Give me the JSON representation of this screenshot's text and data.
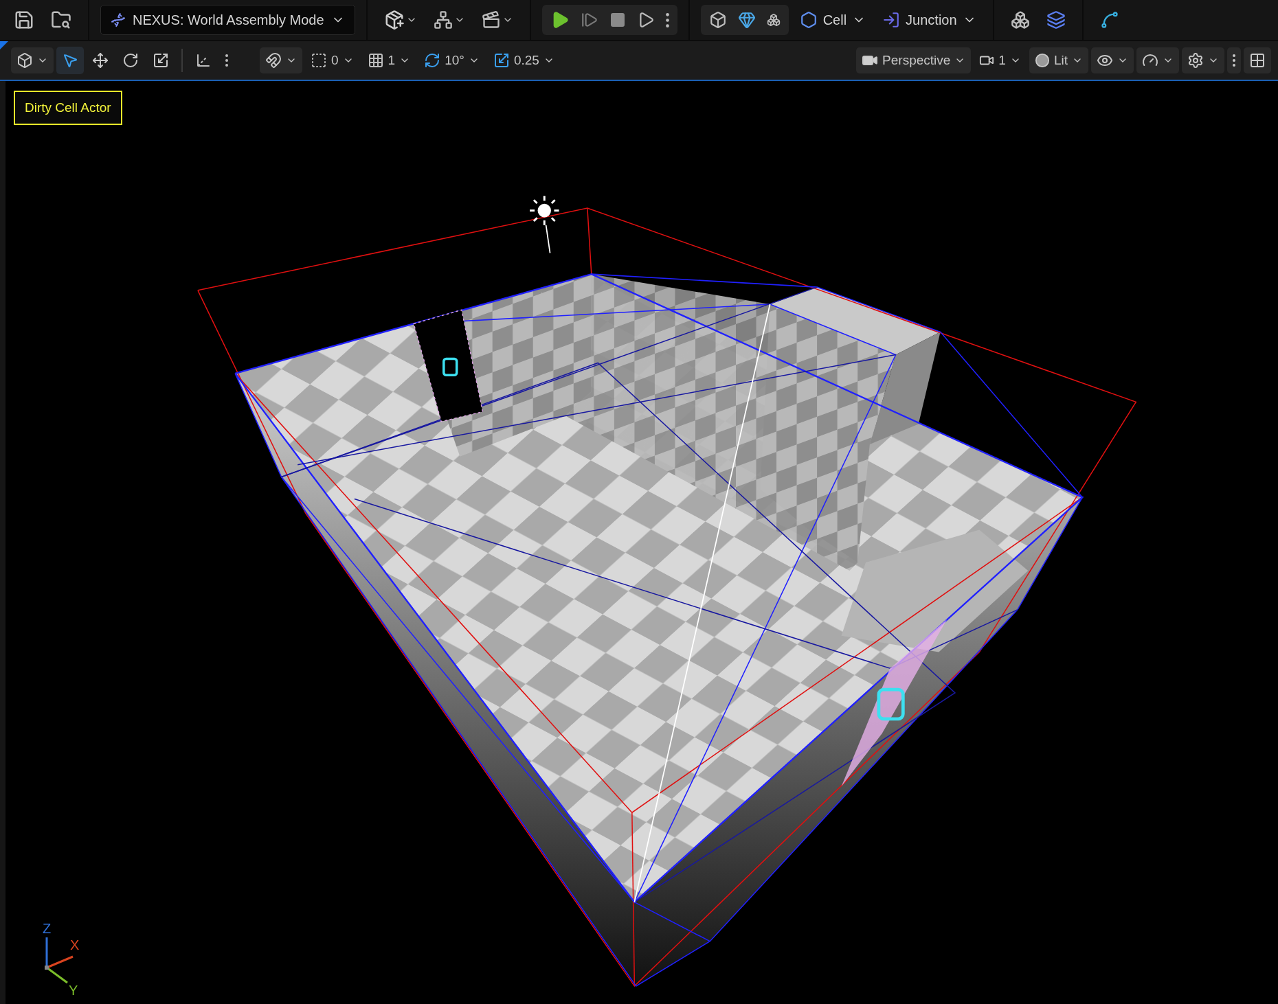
{
  "toolbar": {
    "mode_selector": "NEXUS: World Assembly Mode",
    "menus": [
      {
        "kind": "cell",
        "label": "Cell"
      },
      {
        "kind": "junction",
        "label": "Junction"
      }
    ]
  },
  "viewport_toolbar": {
    "tools": [
      {
        "kind": "select",
        "selected": true
      },
      {
        "kind": "move",
        "selected": false
      },
      {
        "kind": "rotate",
        "selected": false
      },
      {
        "kind": "scale",
        "selected": false
      }
    ],
    "snaps": [
      {
        "kind": "surface",
        "value": "0",
        "active": false
      },
      {
        "kind": "grid",
        "value": "1",
        "active": false
      },
      {
        "kind": "rotation",
        "value": "10°",
        "active": true
      },
      {
        "kind": "scale",
        "value": "0.25",
        "active": true
      }
    ],
    "view_mode": "Perspective",
    "camera_speed": "1",
    "lighting": "Lit"
  },
  "viewport": {
    "badge": "Dirty Cell Actor",
    "axes": [
      {
        "kind": "z",
        "label": "Z",
        "color": "#2f6fd6"
      },
      {
        "kind": "x",
        "label": "X",
        "color": "#d9431f"
      },
      {
        "kind": "y",
        "label": "Y",
        "color": "#7bbd2a"
      }
    ]
  }
}
